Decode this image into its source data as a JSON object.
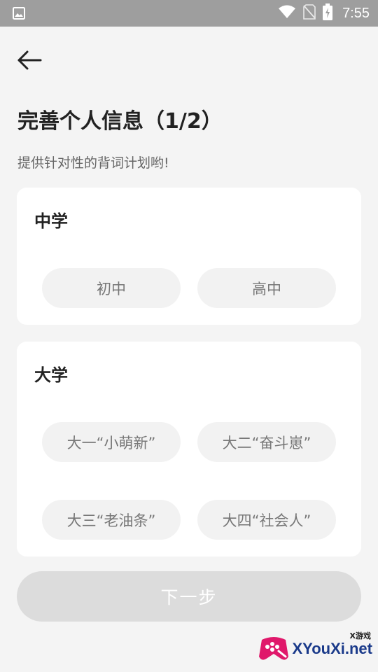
{
  "status_bar": {
    "time": "7:55",
    "icons": [
      "image-icon",
      "wifi-icon",
      "no-sim-icon",
      "battery-icon"
    ]
  },
  "header": {
    "back_icon": "arrow-left-icon",
    "title": "完善个人信息（1/2）",
    "subtitle": "提供针对性的背词计划哟!"
  },
  "sections": {
    "middle_school": {
      "title": "中学",
      "options": [
        "初中",
        "高中"
      ]
    },
    "college": {
      "title": "大学",
      "options": [
        "大一“小萌新”",
        "大二“奋斗崽”",
        "大三“老油条”",
        "大四“社会人”"
      ]
    }
  },
  "actions": {
    "next_label": "下一步"
  },
  "watermark": {
    "small_label": "X游戏",
    "brand_text": "XYouXi.net"
  },
  "colors": {
    "status_bar_bg": "#9e9e9e",
    "page_bg": "#f4f4f4",
    "card_bg": "#ffffff",
    "pill_bg": "#f2f2f2",
    "button_disabled_bg": "#dcdcdc"
  }
}
